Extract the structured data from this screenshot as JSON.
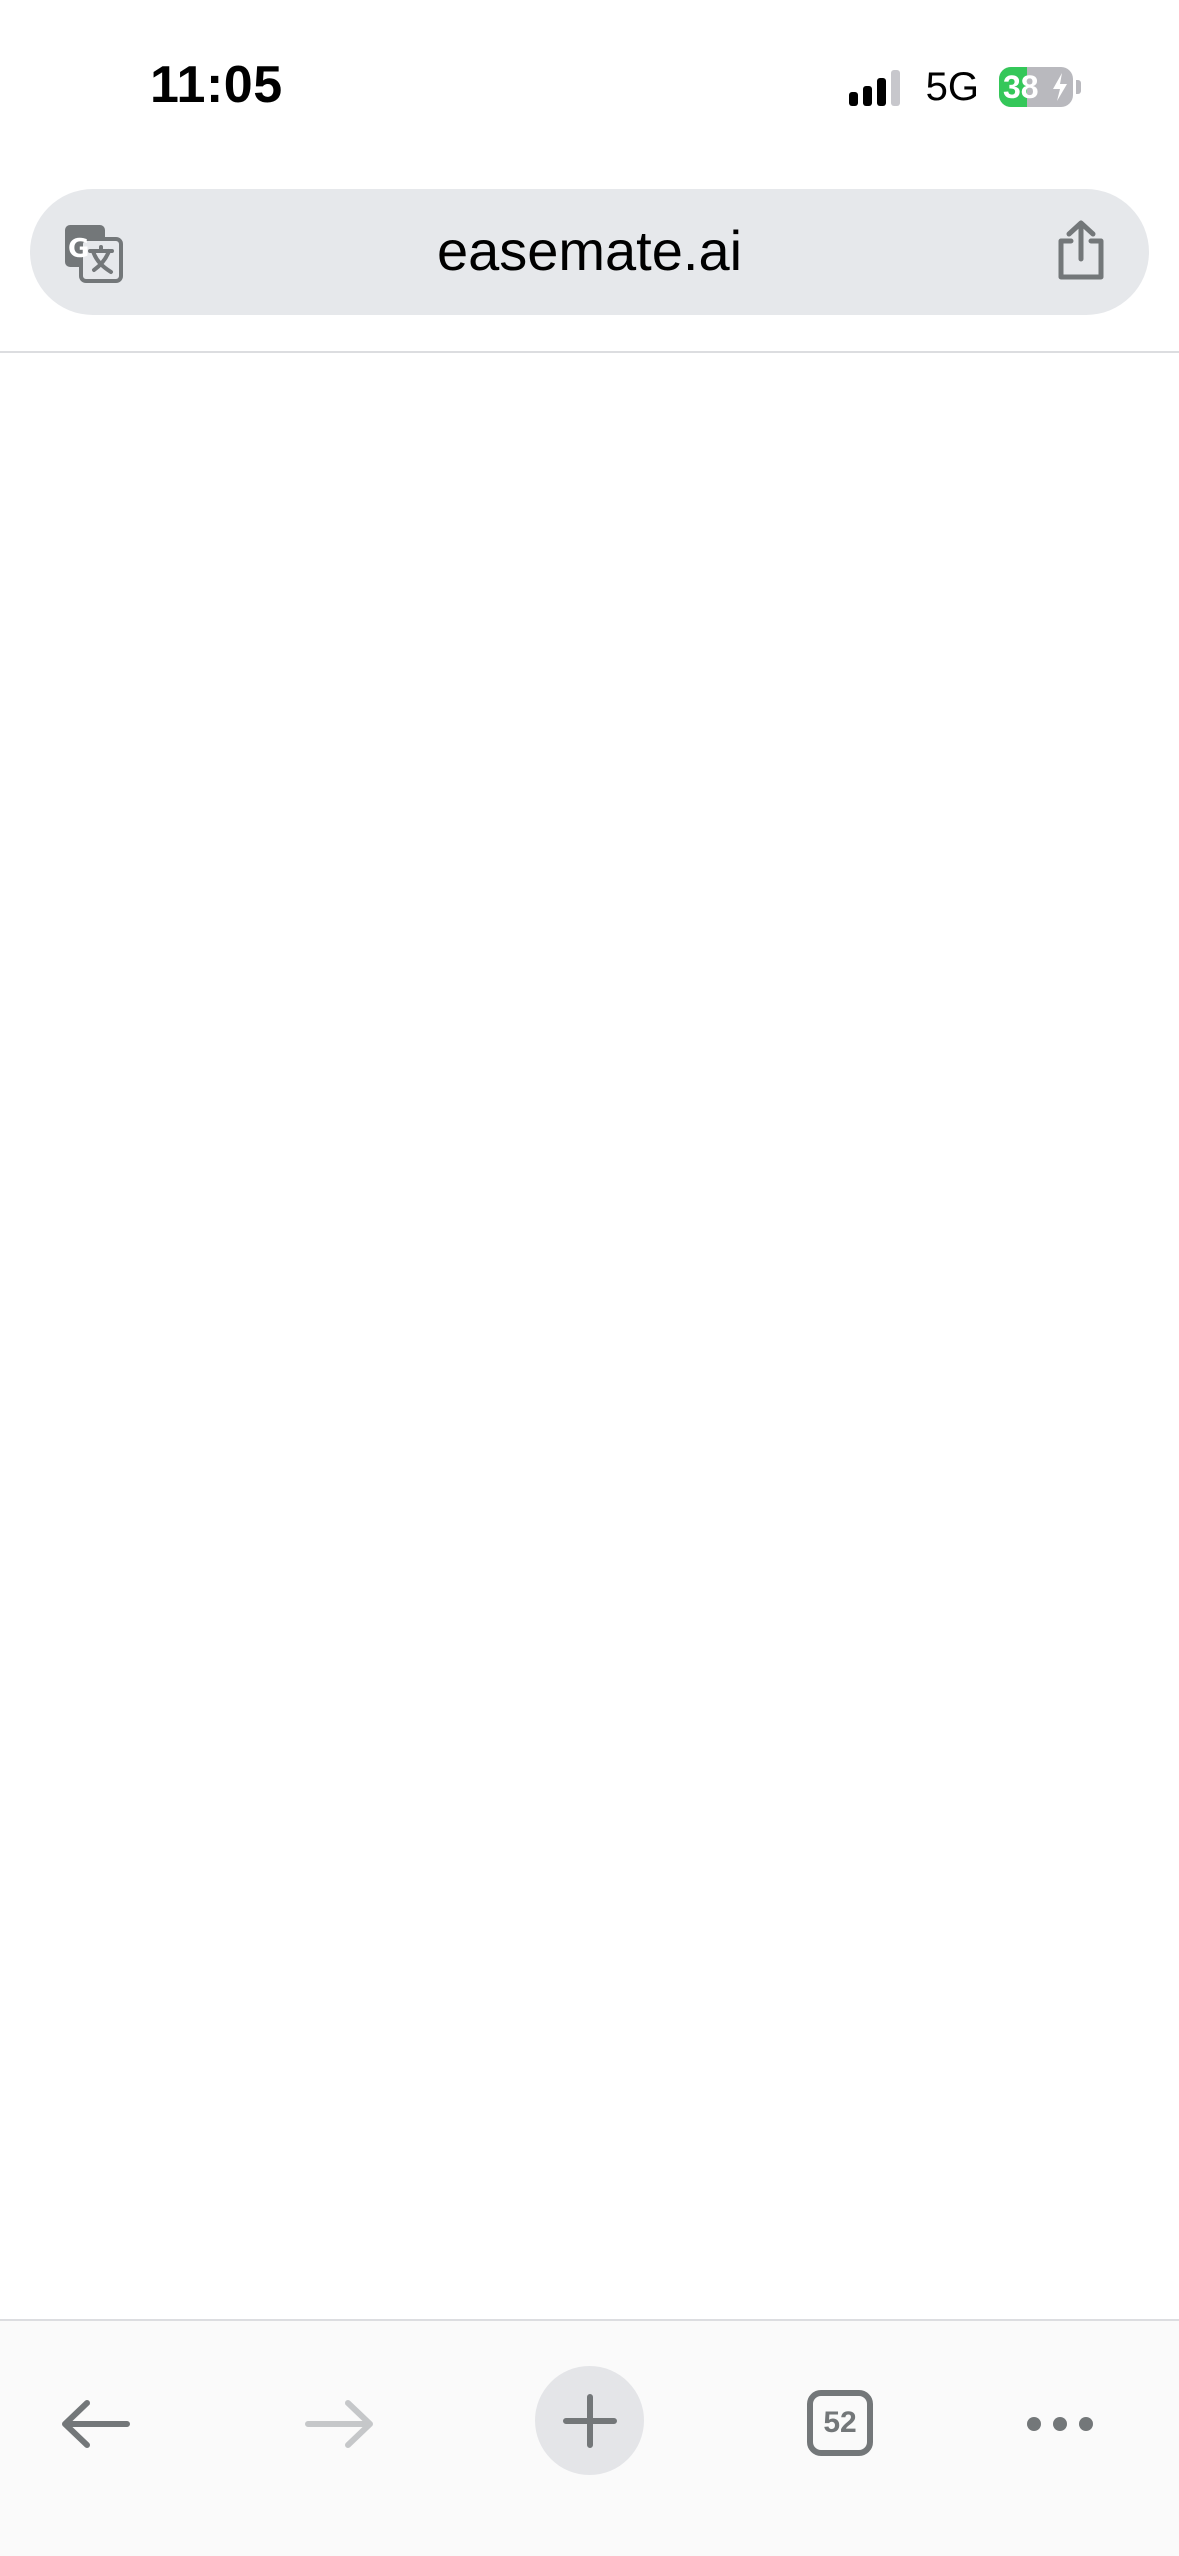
{
  "status_bar": {
    "time": "11:05",
    "network": "5G",
    "battery_percent": "38",
    "battery_level": 0.38,
    "signal_bars_active": 3,
    "signal_bars_total": 4
  },
  "address_bar": {
    "url": "easemate.ai",
    "left_icon": "google-translate-icon",
    "right_icon": "share-icon"
  },
  "toolbar": {
    "back_icon": "arrow-left-icon",
    "forward_icon": "arrow-right-icon",
    "forward_enabled": false,
    "new_tab_icon": "plus-icon",
    "tab_count": "52",
    "menu_icon": "more-dots-icon"
  },
  "colors": {
    "address_bar_bg": "#e6e8eb",
    "icon_gray": "#737779",
    "icon_disabled": "#c5c7c9",
    "battery_green": "#34c759"
  }
}
